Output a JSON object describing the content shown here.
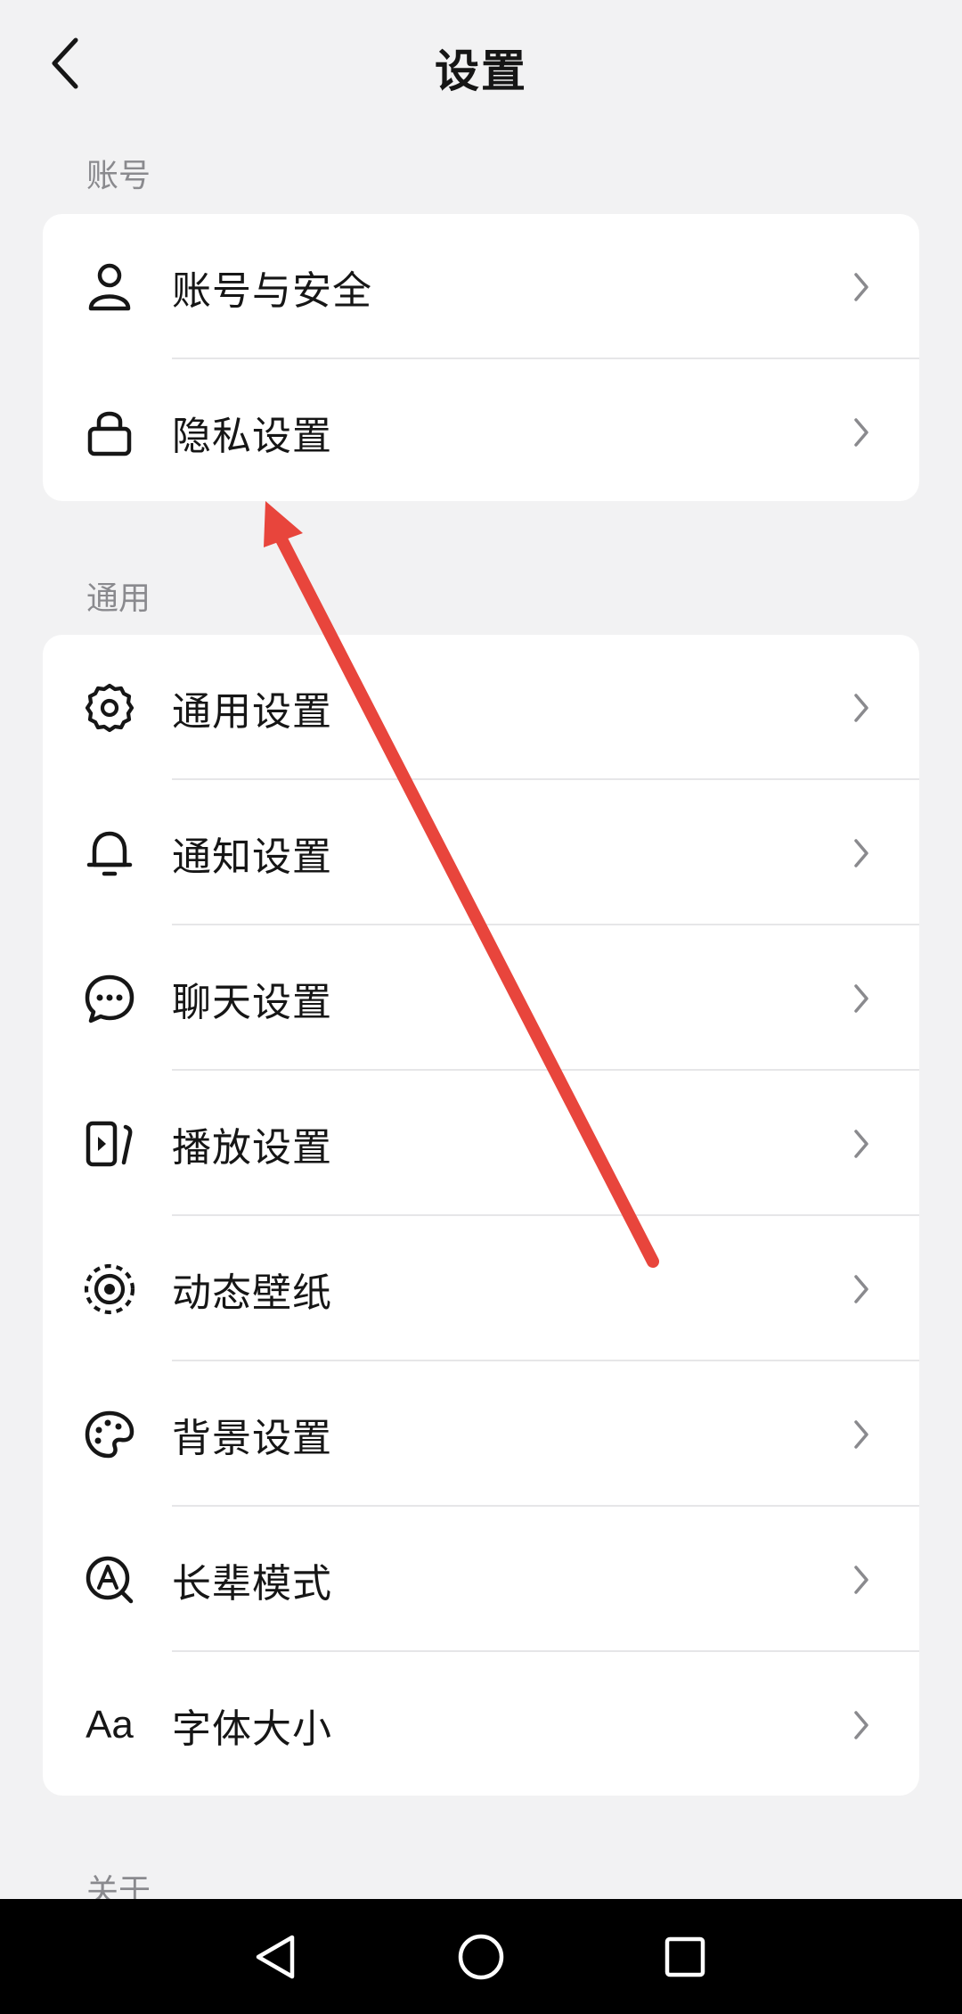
{
  "header": {
    "title": "设置",
    "back_icon": "chevron-left-icon"
  },
  "sections": [
    {
      "label": "账号"
    },
    {
      "label": "通用"
    },
    {
      "label": "关于"
    }
  ],
  "account_items": [
    {
      "label": "账号与安全",
      "icon": "user-icon"
    },
    {
      "label": "隐私设置",
      "icon": "lock-icon"
    }
  ],
  "general_items": [
    {
      "label": "通用设置",
      "icon": "gear-icon"
    },
    {
      "label": "通知设置",
      "icon": "bell-icon"
    },
    {
      "label": "聊天设置",
      "icon": "chat-bubble-icon"
    },
    {
      "label": "播放设置",
      "icon": "play-icon"
    },
    {
      "label": "动态壁纸",
      "icon": "live-wallpaper-icon"
    },
    {
      "label": "背景设置",
      "icon": "palette-icon"
    },
    {
      "label": "长辈模式",
      "icon": "elder-mode-icon"
    },
    {
      "label": "字体大小",
      "icon": "font-size-icon",
      "glyph": "Aa"
    }
  ],
  "colors": {
    "background": "#f2f2f3",
    "card": "#ffffff",
    "annotation_arrow": "#e8453c",
    "navbar": "#000000"
  }
}
